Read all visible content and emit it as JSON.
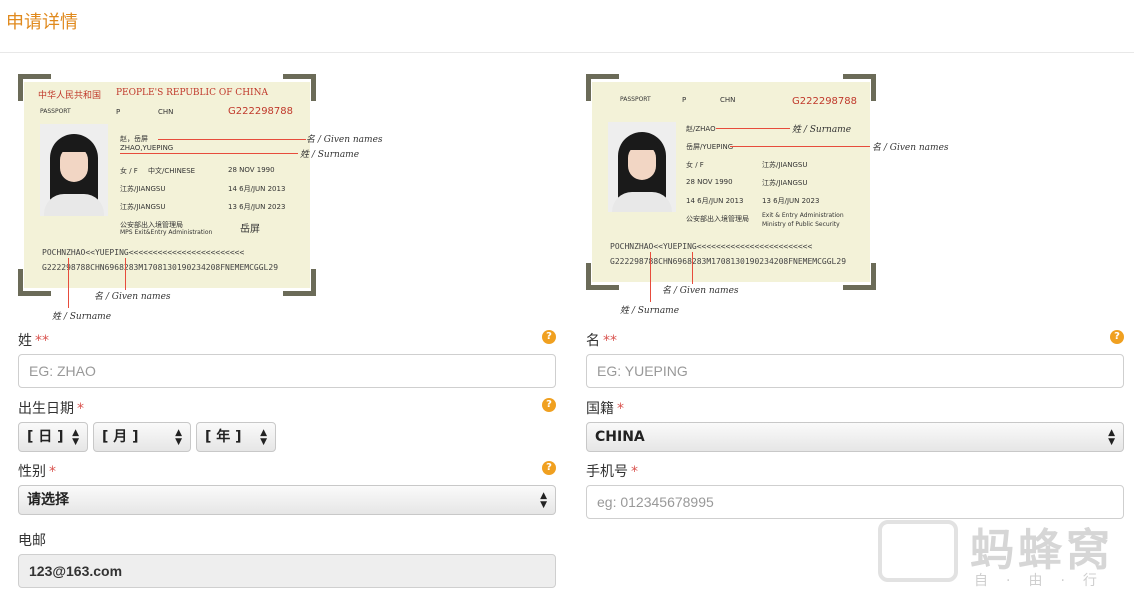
{
  "header": {
    "title": "申请详情"
  },
  "passport_left": {
    "header_cn": "中华人民共和国",
    "header_en": "PEOPLE'S REPUBLIC OF CHINA",
    "passport_label": "PASSPORT",
    "type": "P",
    "country_code": "CHN",
    "passport_no": "G222298788",
    "name_cn": "赵，岳屏",
    "name_en": "ZHAO,YUEPING",
    "sex": "女 / F",
    "nationality": "中文/CHINESE",
    "dob": "28 NOV 1990",
    "place_of_birth": "江苏/JIANGSU",
    "date_of_issue": "14 6月/JUN 2013",
    "place_of_issue": "江苏/JIANGSU",
    "date_of_expiry": "13 6月/JUN 2023",
    "authority_cn": "公安部出入境管理局",
    "authority_en": "MPS Exit&Entry Administration",
    "signature": "岳屏",
    "mrz1": "POCHNZHAO<<YUEPING<<<<<<<<<<<<<<<<<<<<<<<<",
    "mrz2": "G222298788CHN6968283M1708130190234208FNEMEMCGGL29",
    "callout_given": "名 / Given names",
    "callout_surname": "姓 / Surname",
    "callout_given_bottom": "名 / Given names",
    "callout_surname_bottom": "姓 / Surname"
  },
  "passport_right": {
    "passport_label": "PASSPORT",
    "type": "P",
    "country_code": "CHN",
    "passport_no": "G222298788",
    "surname": "赵/ZHAO",
    "given": "岳屏/YUEPING",
    "sex": "女 / F",
    "place_of_birth": "江苏/JIANGSU",
    "dob": "28 NOV 1990",
    "place_of_issue": "江苏/JIANGSU",
    "date_of_issue": "14 6月/JUN 2013",
    "date_of_expiry": "13 6月/JUN 2023",
    "authority_cn": "公安部出入境管理局",
    "authority_en1": "Exit & Entry Administration",
    "authority_en2": "Ministry of Public Security",
    "mrz1": "POCHNZHAO<<YUEPING<<<<<<<<<<<<<<<<<<<<<<<<",
    "mrz2": "G222298788CHN6968283M1708130190234208FNEMEMCGGL29",
    "callout_surname": "姓 / Surname",
    "callout_given": "名 / Given names",
    "callout_given_bottom": "名 / Given names",
    "callout_surname_bottom": "姓 / Surname"
  },
  "form": {
    "surname_label": "姓",
    "surname_req": "**",
    "surname_placeholder": "EG: ZHAO",
    "given_label": "名",
    "given_req": "**",
    "given_placeholder": "EG: YUEPING",
    "dob_label": "出生日期",
    "dob_req": "*",
    "dob_day": "[ 日 ]",
    "dob_month": "[ 月 ]",
    "dob_year": "[ 年 ]",
    "nationality_label": "国籍",
    "nationality_req": "*",
    "nationality_value": "CHINA",
    "gender_label": "性别",
    "gender_req": "*",
    "gender_value": "请选择",
    "phone_label": "手机号",
    "phone_req": "*",
    "phone_placeholder": "eg: 012345678995",
    "email_label": "电邮",
    "email_value": "123@163.com",
    "help_glyph": "?"
  },
  "watermark": {
    "title": "蚂蜂窝",
    "subtitle": "自·由·行"
  }
}
